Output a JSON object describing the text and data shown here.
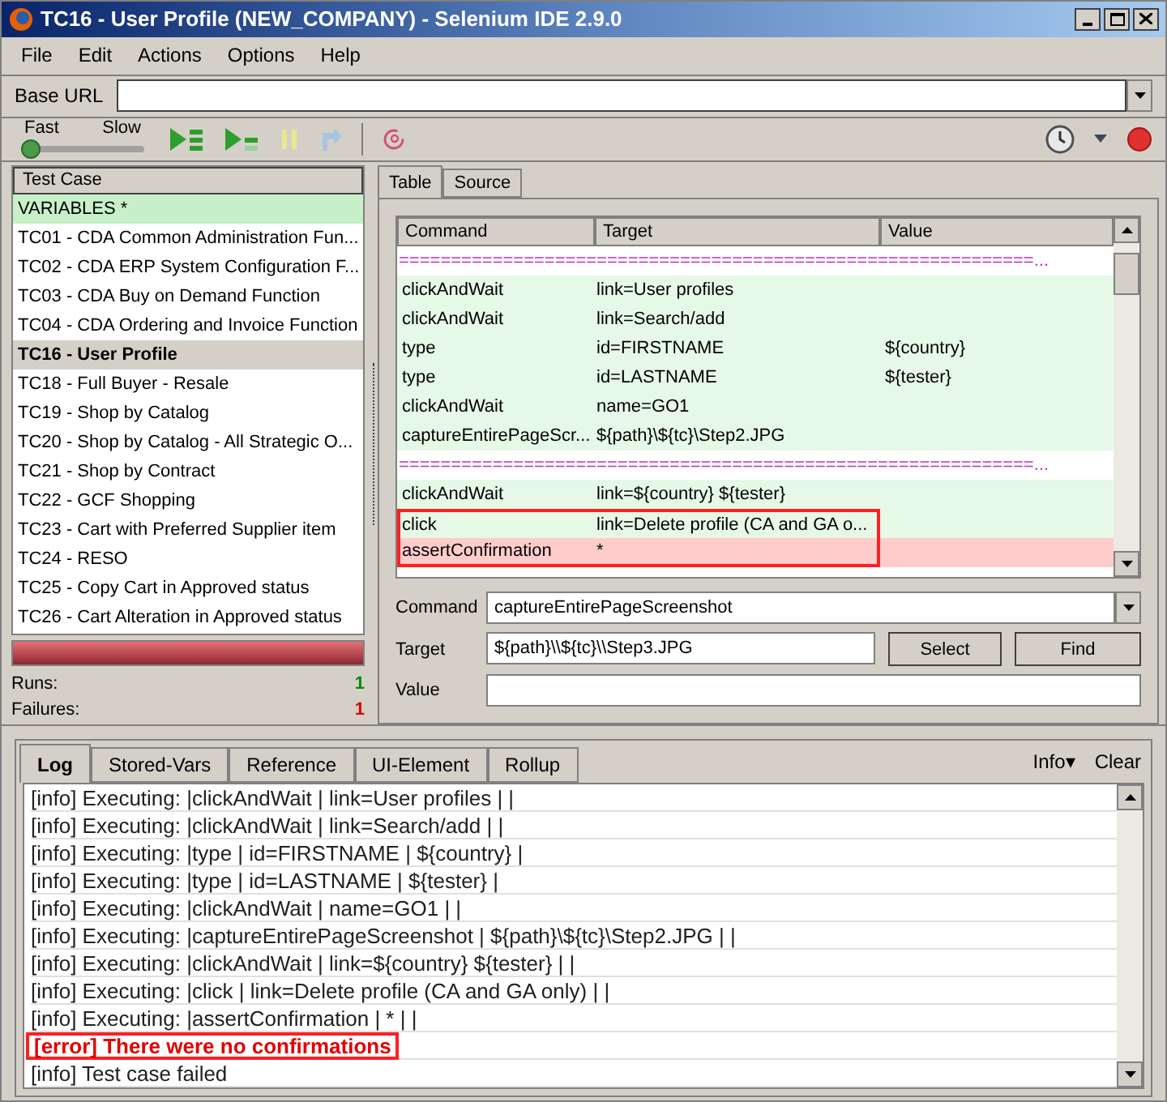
{
  "window": {
    "title": "TC16 - User Profile (NEW_COMPANY) - Selenium IDE 2.9.0"
  },
  "menu": [
    {
      "label": "File"
    },
    {
      "label": "Edit"
    },
    {
      "label": "Actions"
    },
    {
      "label": "Options"
    },
    {
      "label": "Help"
    }
  ],
  "base_url": {
    "label": "Base URL"
  },
  "speed": {
    "fast": "Fast",
    "slow": "Slow",
    "level": 0
  },
  "test_cases": {
    "header": "Test Case",
    "items": [
      {
        "label": "VARIABLES *",
        "selected": false,
        "passed": true
      },
      {
        "label": "TC01 - CDA Common Administration Fun...",
        "selected": false,
        "passed": false
      },
      {
        "label": "TC02 - CDA ERP System Configuration F...",
        "selected": false,
        "passed": false
      },
      {
        "label": "TC03 - CDA Buy on Demand Function",
        "selected": false,
        "passed": false
      },
      {
        "label": "TC04 - CDA Ordering and Invoice Function",
        "selected": false,
        "passed": false
      },
      {
        "label": "TC16 - User Profile",
        "selected": true,
        "passed": false
      },
      {
        "label": "TC18 - Full Buyer - Resale",
        "selected": false,
        "passed": false
      },
      {
        "label": "TC19 - Shop by Catalog",
        "selected": false,
        "passed": false
      },
      {
        "label": "TC20 - Shop by Catalog - All Strategic O...",
        "selected": false,
        "passed": false
      },
      {
        "label": "TC21 - Shop by Contract",
        "selected": false,
        "passed": false
      },
      {
        "label": "TC22 - GCF Shopping",
        "selected": false,
        "passed": false
      },
      {
        "label": "TC23 - Cart with Preferred Supplier item",
        "selected": false,
        "passed": false
      },
      {
        "label": "TC24 - RESO",
        "selected": false,
        "passed": false
      },
      {
        "label": "TC25 - Copy Cart in Approved status",
        "selected": false,
        "passed": false
      },
      {
        "label": "TC26 - Cart Alteration in Approved status",
        "selected": false,
        "passed": false
      }
    ]
  },
  "progress": {
    "level": 1,
    "failed": true
  },
  "results": {
    "runs_label": "Runs:",
    "runs": "1",
    "failures_label": "Failures:",
    "failures": "1"
  },
  "editor_tabs": [
    {
      "label": "Table",
      "selected": true
    },
    {
      "label": "Source",
      "selected": false
    }
  ],
  "table": {
    "columns": [
      "Command",
      "Target",
      "Value"
    ],
    "rows": [
      {
        "kind": "separator",
        "text": "=============================================================...",
        "passed": false,
        "failed": false,
        "boxed": false
      },
      {
        "kind": "command",
        "command": "clickAndWait",
        "target": "link=User profiles",
        "passed": true,
        "failed": false,
        "boxed": false
      },
      {
        "kind": "command",
        "command": "clickAndWait",
        "target": "link=Search/add",
        "passed": true,
        "failed": false,
        "boxed": false
      },
      {
        "kind": "command",
        "command": "type",
        "target": "id=FIRSTNAME",
        "value": "${country}",
        "passed": true,
        "failed": false,
        "boxed": false
      },
      {
        "kind": "command",
        "command": "type",
        "target": "id=LASTNAME",
        "value": "${tester}",
        "passed": true,
        "failed": false,
        "boxed": false
      },
      {
        "kind": "command",
        "command": "clickAndWait",
        "target": "name=GO1",
        "passed": true,
        "failed": false,
        "boxed": false
      },
      {
        "kind": "command",
        "command": "captureEntirePageScr...",
        "target": "${path}\\${tc}\\Step2.JPG",
        "passed": true,
        "failed": false,
        "boxed": false
      },
      {
        "kind": "separator",
        "text": "=============================================================...",
        "passed": false,
        "failed": false,
        "boxed": false
      },
      {
        "kind": "command",
        "command": "clickAndWait",
        "target": "link=${country} ${tester}",
        "passed": true,
        "failed": false,
        "boxed": false
      },
      {
        "kind": "command",
        "command": "click",
        "target": "link=Delete profile (CA and GA o...",
        "passed": true,
        "failed": false,
        "boxed": true
      },
      {
        "kind": "command",
        "command": "assertConfirmation",
        "target": "*",
        "passed": false,
        "failed": true,
        "boxed": true
      }
    ]
  },
  "fields": {
    "command_label": "Command",
    "command": "captureEntirePageScreenshot",
    "target_label": "Target",
    "target": "${path}\\\\${tc}\\\\Step3.JPG",
    "select": "Select",
    "find": "Find",
    "value_label": "Value"
  },
  "log_tabs": [
    {
      "label": "Log",
      "selected": true
    },
    {
      "label": "Stored-Vars",
      "selected": false
    },
    {
      "label": "Reference",
      "selected": false
    },
    {
      "label": "UI-Element",
      "selected": false
    },
    {
      "label": "Rollup",
      "selected": false
    }
  ],
  "log_actions": {
    "info": "Info▾",
    "clear": "Clear"
  },
  "log": [
    {
      "error": false,
      "text": "[info] Executing: |clickAndWait | link=User profiles | |",
      "boxed": false
    },
    {
      "error": false,
      "text": "[info] Executing: |clickAndWait | link=Search/add | |",
      "boxed": false
    },
    {
      "error": false,
      "text": "[info] Executing: |type | id=FIRSTNAME | ${country} |",
      "boxed": false
    },
    {
      "error": false,
      "text": "[info] Executing: |type | id=LASTNAME | ${tester} |",
      "boxed": false
    },
    {
      "error": false,
      "text": "[info] Executing: |clickAndWait | name=GO1 | |",
      "boxed": false
    },
    {
      "error": false,
      "text": "[info] Executing: |captureEntirePageScreenshot | ${path}\\${tc}\\Step2.JPG | |",
      "boxed": false
    },
    {
      "error": false,
      "text": "[info] Executing: |clickAndWait | link=${country} ${tester} | |",
      "boxed": false
    },
    {
      "error": false,
      "text": "[info] Executing: |click | link=Delete profile (CA and GA only) | |",
      "boxed": false
    },
    {
      "error": false,
      "text": "[info] Executing: |assertConfirmation | * | |",
      "boxed": false
    },
    {
      "error": true,
      "text": "[error] There were no confirmations",
      "boxed": true
    },
    {
      "error": false,
      "text": "[info] Test case failed",
      "boxed": false
    }
  ]
}
